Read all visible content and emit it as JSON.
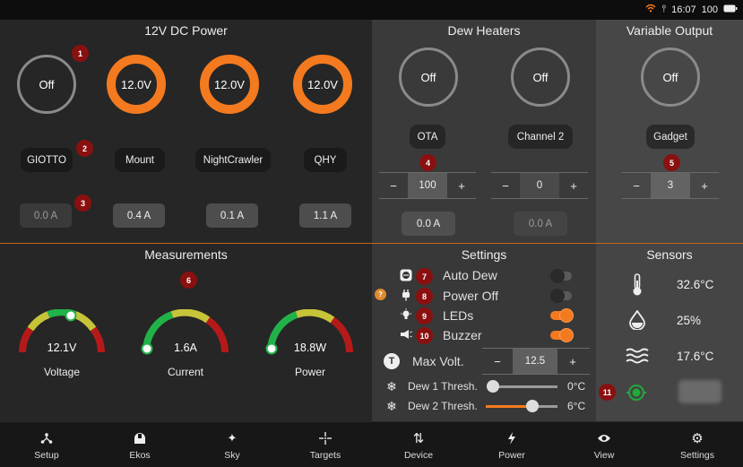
{
  "status": {
    "time": "16:07",
    "battery": "100"
  },
  "power": {
    "title": "12V DC Power",
    "ports": [
      {
        "state": "Off",
        "name": "GIOTTO",
        "current": "0.0 A",
        "on": false
      },
      {
        "state": "12.0V",
        "name": "Mount",
        "current": "0.4 A",
        "on": true
      },
      {
        "state": "12.0V",
        "name": "NightCrawler",
        "current": "0.1 A",
        "on": true
      },
      {
        "state": "12.0V",
        "name": "QHY",
        "current": "1.1 A",
        "on": true
      }
    ]
  },
  "dew": {
    "title": "Dew Heaters",
    "channels": [
      {
        "state": "Off",
        "name": "OTA",
        "value": "100",
        "current": "0.0 A"
      },
      {
        "state": "Off",
        "name": "Channel 2",
        "value": "0",
        "current": "0.0 A"
      }
    ]
  },
  "variable": {
    "title": "Variable Output",
    "state": "Off",
    "name": "Gadget",
    "value": "3"
  },
  "measurements": {
    "title": "Measurements",
    "gauges": [
      {
        "value": "12.1V",
        "label": "Voltage",
        "level": 0.62
      },
      {
        "value": "1.6A",
        "label": "Current",
        "level": 0.0
      },
      {
        "value": "18.8W",
        "label": "Power",
        "level": 0.0
      }
    ]
  },
  "settings": {
    "title": "Settings",
    "toggles": [
      {
        "label": "Auto Dew",
        "on": false,
        "icon": "auto-dew-icon"
      },
      {
        "label": "Power Off",
        "on": false,
        "icon": "plug-icon"
      },
      {
        "label": "LEDs",
        "on": true,
        "icon": "bulb-icon"
      },
      {
        "label": "Buzzer",
        "on": true,
        "icon": "megaphone-icon"
      }
    ],
    "max_volt": {
      "label": "Max Volt.",
      "value": "12.5"
    },
    "thresholds": [
      {
        "label": "Dew 1 Thresh.",
        "value": "0°C",
        "level": 0.0
      },
      {
        "label": "Dew 2 Thresh.",
        "value": "6°C",
        "level": 0.5
      }
    ]
  },
  "sensors": {
    "title": "Sensors",
    "readings": [
      {
        "icon": "thermometer-icon",
        "value": "32.6°C"
      },
      {
        "icon": "humidity-drop-icon",
        "value": "25%"
      },
      {
        "icon": "dewpoint-waves-icon",
        "value": "17.6°C"
      }
    ]
  },
  "badges": [
    "1",
    "2",
    "3",
    "4",
    "5",
    "6",
    "7",
    "8",
    "9",
    "10",
    "11",
    "?"
  ],
  "nav": [
    {
      "label": "Setup",
      "icon": "setup-icon"
    },
    {
      "label": "Ekos",
      "icon": "ekos-icon"
    },
    {
      "label": "Sky",
      "icon": "sky-icon"
    },
    {
      "label": "Targets",
      "icon": "targets-icon"
    },
    {
      "label": "Device",
      "icon": "device-icon"
    },
    {
      "label": "Power",
      "icon": "power-icon"
    },
    {
      "label": "View",
      "icon": "view-icon"
    },
    {
      "label": "Settings",
      "icon": "settings-icon"
    }
  ],
  "colors": {
    "accent": "#f47a1f",
    "badge": "#8a1010",
    "divider": "#c6661b"
  }
}
